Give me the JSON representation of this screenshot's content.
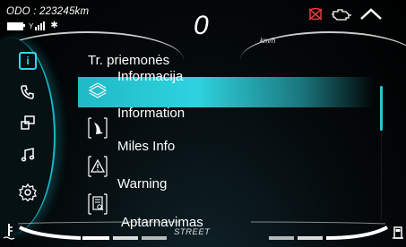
{
  "status": {
    "odometer": "ODO : 223245km",
    "speed": "0",
    "speed_unit": "km/h"
  },
  "menu": {
    "title": "Tr. priemonės",
    "items": [
      {
        "label": "Informacija",
        "icon": "layers-icon",
        "selected": true
      },
      {
        "label": "Information",
        "icon": "tire-pressure-icon",
        "selected": false
      },
      {
        "label": "Miles Info",
        "icon": "warning-triangle-icon",
        "selected": false
      },
      {
        "label": "Warning",
        "icon": "service-document-icon",
        "selected": false
      },
      {
        "label": "Aptarnavimas",
        "icon": "",
        "selected": false
      }
    ]
  },
  "sidebar": {
    "items": [
      {
        "icon": "info-icon",
        "active": true
      },
      {
        "icon": "phone-icon",
        "active": false
      },
      {
        "icon": "screen-mirror-icon",
        "active": false
      },
      {
        "icon": "music-note-icon",
        "active": false
      },
      {
        "icon": "settings-gear-icon",
        "active": false
      }
    ]
  },
  "bottom": {
    "mode": "STREET"
  },
  "colors": {
    "accent": "#2ed3df",
    "warning": "#e23b3b",
    "background": "#000000"
  }
}
